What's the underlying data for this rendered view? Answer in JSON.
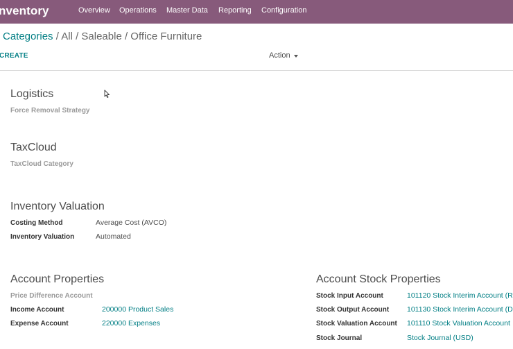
{
  "navbar": {
    "app_title": "nventory",
    "menu": [
      "Overview",
      "Operations",
      "Master Data",
      "Reporting",
      "Configuration"
    ]
  },
  "breadcrumb": {
    "root": "Categories",
    "sep": "/",
    "path": "All / Saleable / Office Furniture"
  },
  "control": {
    "create_label": "CREATE",
    "action_label": "Action"
  },
  "logistics": {
    "title": "Logistics",
    "force_removal_label": "Force Removal Strategy"
  },
  "taxcloud": {
    "title": "TaxCloud",
    "category_label": "TaxCloud Category"
  },
  "inventory_valuation": {
    "title": "Inventory Valuation",
    "costing_method_label": "Costing Method",
    "costing_method_value": "Average Cost (AVCO)",
    "valuation_label": "Inventory Valuation",
    "valuation_value": "Automated"
  },
  "account_properties": {
    "title": "Account Properties",
    "price_diff_label": "Price Difference Account",
    "income_label": "Income Account",
    "income_value": "200000 Product Sales",
    "expense_label": "Expense Account",
    "expense_value": "220000 Expenses"
  },
  "account_stock_properties": {
    "title": "Account Stock Properties",
    "input_label": "Stock Input Account",
    "input_value": "101120 Stock Interim Account (R",
    "output_label": "Stock Output Account",
    "output_value": "101130 Stock Interim Account (D",
    "valuation_label": "Stock Valuation Account",
    "valuation_value": "101110 Stock Valuation Account",
    "journal_label": "Stock Journal",
    "journal_value": "Stock Journal (USD)"
  },
  "colors": {
    "navbar": "#875a7b",
    "link": "#017e84"
  }
}
